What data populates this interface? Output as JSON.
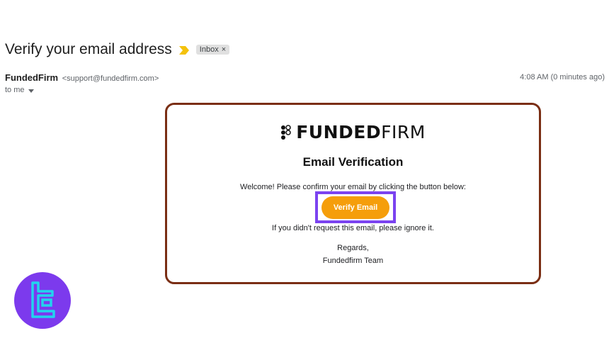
{
  "email": {
    "subject": "Verify your email address",
    "label": "Inbox",
    "label_close": "×",
    "sender_name": "FundedFirm",
    "sender_email": "<support@fundedfirm.com>",
    "time": "4:08 AM (0 minutes ago)",
    "recipient": "to me"
  },
  "body": {
    "logo_bold": "FUNDED",
    "logo_thin": "FIRM",
    "title": "Email Verification",
    "welcome": "Welcome! Please confirm your email by clicking the button below:",
    "button_label": "Verify Email",
    "ignore_text": "If you didn't request this email, please ignore it.",
    "regards": "Regards,",
    "team": "Fundedfirm Team"
  },
  "colors": {
    "accent_button": "#f59e0b",
    "card_border": "#7a2e14",
    "highlight_box": "#7b43f0",
    "badge": "#7c3aed"
  },
  "icons": [
    "important-marker-icon",
    "dropdown-caret-icon",
    "fundedfirm-logo-icon",
    "tradingfinder-badge-icon"
  ]
}
